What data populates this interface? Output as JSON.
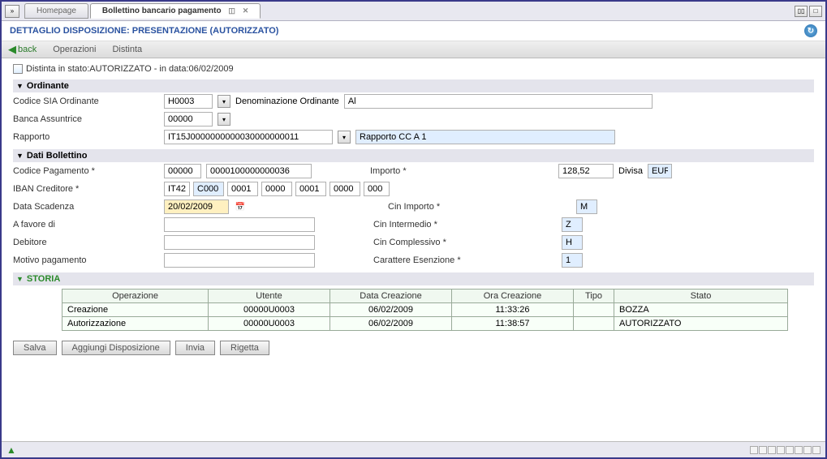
{
  "tabs": {
    "homepage": "Homepage",
    "active": "Bollettino bancario pagamento"
  },
  "title": "DETTAGLIO DISPOSIZIONE: PRESENTAZIONE (AUTORIZZATO)",
  "toolbar": {
    "back": "back",
    "operazioni": "Operazioni",
    "distinta": "Distinta"
  },
  "status_line": "Distinta in stato:AUTORIZZATO - in data:06/02/2009",
  "section_ordinante": "Ordinante",
  "ordinante": {
    "codice_sia_label": "Codice SIA Ordinante",
    "codice_sia": "H0003",
    "denom_label": "Denominazione Ordinante",
    "denom": "Al",
    "banca_label": "Banca Assuntrice",
    "banca": "00000",
    "rapporto_label": "Rapporto",
    "rapporto": "IT15J0000000000030000000011",
    "rapporto_desc": "Rapporto CC A 1"
  },
  "section_bollettino": "Dati Bollettino",
  "bollettino": {
    "codice_pag_label": "Codice Pagamento *",
    "codice_pag_a": "00000",
    "codice_pag_b": "0000100000000036",
    "importo_label": "Importo *",
    "importo": "128,52",
    "divisa_label": "Divisa",
    "divisa": "EUR",
    "iban_label": "IBAN Creditore *",
    "iban": [
      "IT42",
      "C000",
      "0001",
      "0000",
      "0001",
      "0000",
      "000"
    ],
    "scadenza_label": "Data Scadenza",
    "scadenza": "20/02/2009",
    "cin_importo_label": "Cin Importo *",
    "cin_importo": "M",
    "favore_label": "A favore di",
    "favore": "",
    "cin_intermedio_label": "Cin Intermedio *",
    "cin_intermedio": "Z",
    "debitore_label": "Debitore",
    "debitore": "",
    "cin_compl_label": "Cin Complessivo *",
    "cin_compl": "H",
    "motivo_label": "Motivo pagamento",
    "motivo": "",
    "esenzione_label": "Carattere Esenzione *",
    "esenzione": "1"
  },
  "section_storia": "STORIA",
  "storia": {
    "headers": [
      "Operazione",
      "Utente",
      "Data Creazione",
      "Ora Creazione",
      "Tipo",
      "Stato"
    ],
    "rows": [
      [
        "Creazione",
        "00000U0003",
        "06/02/2009",
        "11:33:26",
        "",
        "BOZZA"
      ],
      [
        "Autorizzazione",
        "00000U0003",
        "06/02/2009",
        "11:38:57",
        "",
        "AUTORIZZATO"
      ]
    ]
  },
  "buttons": {
    "salva": "Salva",
    "aggiungi": "Aggiungi Disposizione",
    "invia": "Invia",
    "rigetta": "Rigetta"
  }
}
